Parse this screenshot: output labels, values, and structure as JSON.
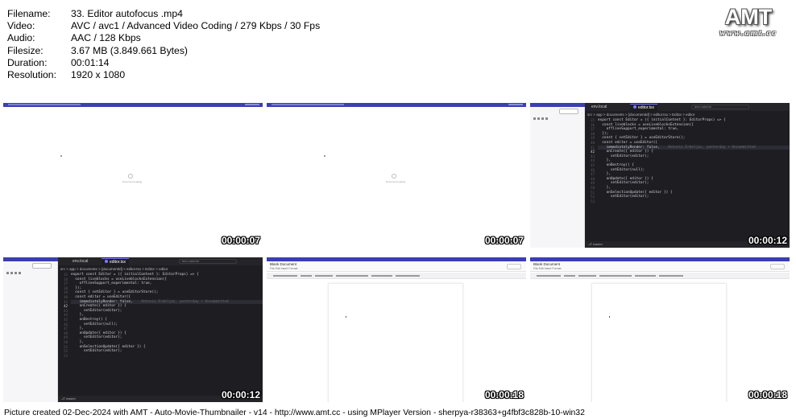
{
  "info": {
    "rows": [
      {
        "label": "Filename:",
        "value": "33. Editor autofocus .mp4"
      },
      {
        "label": "Video:",
        "value": "AVC / avc1 / Advanced Video Coding / 279 Kbps / 30 Fps"
      },
      {
        "label": "Audio:",
        "value": "AAC / 128 Kbps"
      },
      {
        "label": "Filesize:",
        "value": "3.67 MB (3.849.661 Bytes)"
      },
      {
        "label": "Duration:",
        "value": "00:01:14"
      },
      {
        "label": "Resolution:",
        "value": "1920 x 1080"
      }
    ]
  },
  "logo": {
    "big": "AMT",
    "small": "www.amt.cc"
  },
  "thumbnails": [
    {
      "timestamp": "00:00:07"
    },
    {
      "timestamp": "00:00:07"
    },
    {
      "timestamp": "00:00:12"
    },
    {
      "timestamp": "00:00:12"
    },
    {
      "timestamp": "00:00:18"
    },
    {
      "timestamp": "00:00:18"
    }
  ],
  "loading": {
    "text": "Document loading"
  },
  "editor": {
    "tab_left": "env.local",
    "tab_active": "editor.tsx",
    "search": "lenv-tutorial",
    "breadcrumb": "src > app > documents > [documentId] > editor.tsx > Editor > editor",
    "status": "master",
    "lines": [
      {
        "n": "35",
        "t": "export const Editor = ({ initialContent }: EditorProps) => {"
      },
      {
        "n": "36",
        "t": "  const liveblocks = useLiveblocksExtension({"
      },
      {
        "n": "37",
        "t": "    offlineSupport_experimental: true,"
      },
      {
        "n": "38",
        "t": "  });"
      },
      {
        "n": "39",
        "t": "  const { setEditor } = useEditorStore();"
      },
      {
        "n": "40",
        "t": ""
      },
      {
        "n": "41",
        "t": "  const editor = useEditor({"
      },
      {
        "n": "42",
        "t": "    immediatelyRender: false,"
      },
      {
        "n": "43",
        "t": "    onCreate({ editor }) {"
      },
      {
        "n": "44",
        "t": "      setEditor(editor);"
      },
      {
        "n": "45",
        "t": "    },"
      },
      {
        "n": "46",
        "t": "    onDestroy() {"
      },
      {
        "n": "47",
        "t": "      setEditor(null);"
      },
      {
        "n": "48",
        "t": "    },"
      },
      {
        "n": "49",
        "t": "    onUpdate({ editor }) {"
      },
      {
        "n": "50",
        "t": "      setEditor(editor);"
      },
      {
        "n": "51",
        "t": "    },"
      },
      {
        "n": "52",
        "t": "    onSelectionUpdate({ editor }) {"
      },
      {
        "n": "53",
        "t": "      setEditor(editor);"
      }
    ],
    "inline_hint": "Antonio Erdeljac, yesterday • Uncommitted"
  },
  "docs": {
    "title": "Blank Document",
    "menu": "File  Edit  Insert  Format"
  },
  "footer": {
    "text": "Picture created 02-Dec-2024 with AMT - Auto-Movie-Thumbnailer - v14 - http://www.amt.cc - using MPlayer Version - sherpya-r38363+g4fbf3c828b-10-win32"
  }
}
